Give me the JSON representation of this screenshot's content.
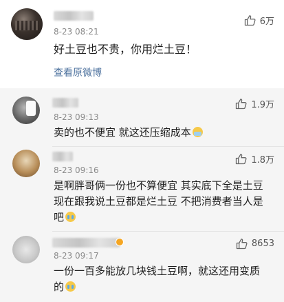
{
  "main_comment": {
    "time": "8-23 08:21",
    "likes": "6万",
    "text": "好土豆也不贵，你用烂土豆！",
    "view_original": "查看原微博"
  },
  "replies": [
    {
      "time": "8-23 09:13",
      "likes": "1.9万",
      "text": "卖的也不便宜 就这还压缩成本"
    },
    {
      "time": "8-23 09:16",
      "likes": "1.8万",
      "lines": [
        "是啊胖哥俩一份也不算便宜 其实底下全是土豆",
        "现在跟我说土豆都是烂土豆 不把消费者当人是",
        "吧"
      ]
    },
    {
      "time": "8-23 09:17",
      "likes": "8653",
      "lines": [
        "一份一百多能放几块钱土豆啊，就这还用变质",
        "的"
      ]
    }
  ],
  "icons": {
    "like": "thumbs-up-icon"
  },
  "colors": {
    "link": "#4a6f9c",
    "reply_bg": "#f5f5f5",
    "time": "#8a8a8a"
  }
}
